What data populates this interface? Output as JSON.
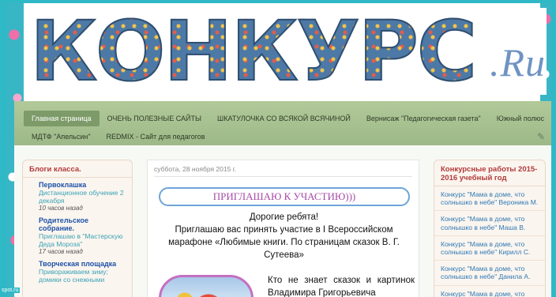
{
  "header": {
    "logo_main": "КОНКУРС",
    "logo_suffix": ".Ru"
  },
  "nav": {
    "row1": [
      "Главная страница",
      "ОЧЕНЬ ПОЛЕЗНЫЕ САЙТЫ",
      "ШКАТУЛОЧКА СО ВСЯКОЙ ВСЯЧИНОЙ",
      "Вернисаж \"Педагогическая газета\"",
      "Южный полюс"
    ],
    "row2": [
      "МДТФ \"Апельсин\"",
      "REDMIX - Сайт для педагогов"
    ],
    "tools_icon": "wrench-icon"
  },
  "left_sidebar": {
    "title": "Блоги класса.",
    "items": [
      {
        "title": "Первоклашка",
        "desc": "Дистанционное обучение 2 декабря",
        "ago": "10 часов назад"
      },
      {
        "title": "Родительское собрание.",
        "desc": "Приглашаю в \"Мастерскую Деда Мороза\"",
        "ago": "17 часов назад"
      },
      {
        "title": "Творческая площадка",
        "desc": "Привораживаем зиму; домики со снежными",
        "ago": ""
      }
    ]
  },
  "post": {
    "date": "суббота, 28 ноября 2015 г.",
    "invite": "ПРИГЛАШАЮ К УЧАСТИЮ)))",
    "greeting": "Дорогие ребята!",
    "body": "Приглашаю вас принять участие в I Всероссийском марафоне «Любимые книги. По страницам сказок В. Г. Сутеева»",
    "para": "Кто не знает сказок и картинок Владимира Григорьевича"
  },
  "right_sidebar": {
    "title": "Конкурсные работы 2015-2016 учебный год",
    "links": [
      "Конкурс \"Мама в доме, что солнышко в небе\" Вероника М.",
      "Конкурс \"Мама в доме, что солнышко в небе\" Маша В.",
      "Конкурс \"Мама в доме, что солнышко в небе\" Кирилл С.",
      "Конкурс \"Мама в доме, что солнышко в небе\" Данила А.",
      "Конкурс \"Мама в доме, что солнышко в небе\" Тимур А."
    ]
  },
  "footer": {
    "source": "spot.ru"
  },
  "colors": {
    "accent_blue": "#2f79b5",
    "nav_green": "#9db987",
    "sidebar_title_red": "#b23a3a",
    "invite_purple": "#a64aa8",
    "teal_bg": "#2fb8c6"
  }
}
